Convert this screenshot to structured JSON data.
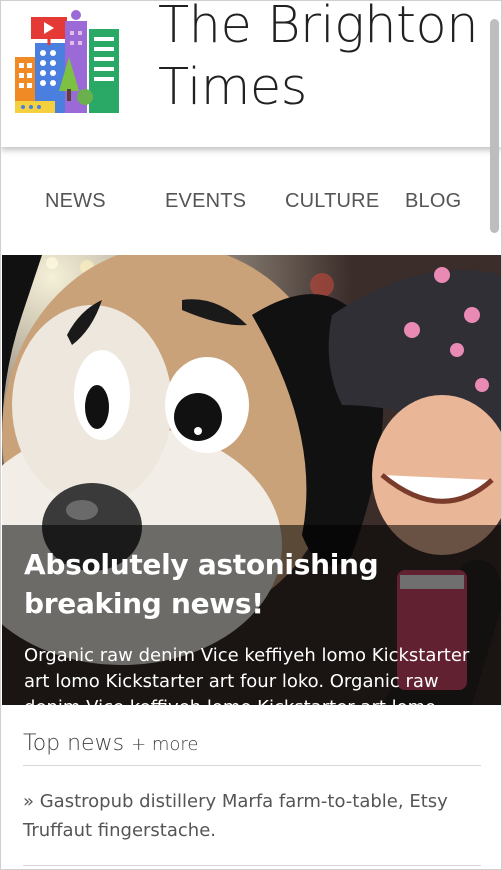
{
  "site": {
    "title": "The Brighton Times"
  },
  "nav": {
    "items": [
      {
        "label": "NEWS"
      },
      {
        "label": "EVENTS"
      },
      {
        "label": "CULTURE"
      },
      {
        "label": "BLOG"
      }
    ]
  },
  "hero": {
    "headline": "Absolutely astonishing breaking news!",
    "excerpt": "Organic raw denim Vice keffiyeh lomo Kickstarter art lomo Kickstarter art four loko. Organic raw denim Vice keffiyeh lomo Kickstarter art lomo"
  },
  "top_news": {
    "title": "Top news",
    "more_label": "+ more",
    "items": [
      {
        "text": "» Gastropub distillery Marfa farm-to-table, Etsy Truffaut fingerstache."
      }
    ]
  },
  "icons": {
    "logo": "city-buildings-logo"
  },
  "colors": {
    "overlay": "#000000",
    "text_dark": "#212121",
    "nav_text": "#555555"
  }
}
